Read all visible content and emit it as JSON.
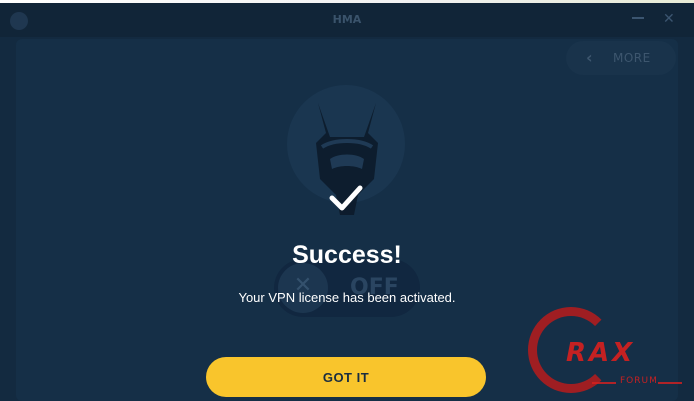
{
  "app": {
    "title": "HMA",
    "more_label": "MORE",
    "toggle_label": "OFF"
  },
  "dialog": {
    "title": "Success!",
    "message": "Your VPN license has been activated.",
    "button_label": "GOT IT"
  },
  "watermark": {
    "text": "RAX",
    "subtext": "FORUM"
  },
  "colors": {
    "background": "#132a40",
    "accent": "#f9c52c",
    "text": "#ffffff"
  },
  "icons": {
    "success": "check-icon",
    "more": "chevron-left-icon",
    "toggle": "close-icon"
  }
}
